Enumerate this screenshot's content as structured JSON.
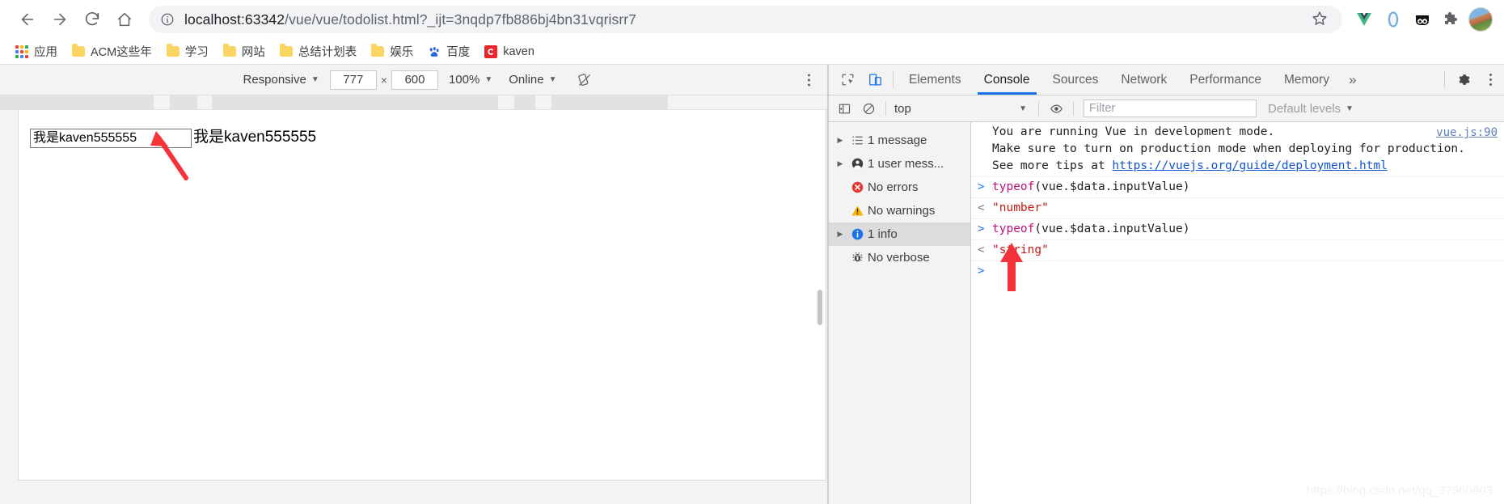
{
  "browser": {
    "nav": {
      "back": "back-arrow",
      "forward": "forward-arrow",
      "reload": "reload",
      "home": "home"
    },
    "address": {
      "host": "localhost:63342",
      "path": "/vue/vue/todolist.html?_ijt=3nqdp7fb886bj4bn31vqrisrr7",
      "full": "localhost:63342/vue/vue/todolist.html?_ijt=3nqdp7fb886bj4bn31vqrisrr7",
      "security_icon": "info-circle-icon",
      "bookmark_icon": "star-icon"
    },
    "bookmarks": [
      {
        "label": "应用",
        "icon": "apps-grid-icon"
      },
      {
        "label": "ACM这些年",
        "icon": "folder-icon"
      },
      {
        "label": "学习",
        "icon": "folder-icon"
      },
      {
        "label": "网站",
        "icon": "folder-icon"
      },
      {
        "label": "总结计划表",
        "icon": "folder-icon"
      },
      {
        "label": "娱乐",
        "icon": "folder-icon"
      },
      {
        "label": "百度",
        "icon": "baidu-paw-icon"
      },
      {
        "label": "kaven",
        "icon": "csdn-red-icon"
      }
    ],
    "extensions": [
      {
        "name": "vue-devtools-icon"
      },
      {
        "name": "blue-ring-icon"
      },
      {
        "name": "dark-panda-icon"
      },
      {
        "name": "puzzle-extensions-icon"
      },
      {
        "name": "profile-avatar"
      }
    ]
  },
  "device_toolbar": {
    "device": "Responsive",
    "width": "777",
    "height": "600",
    "times": "×",
    "zoom": "100%",
    "network": "Online",
    "rotate_icon": "rotate-icon",
    "menu_icon": "more-vertical-icon"
  },
  "page": {
    "input_value": "我是kaven555555",
    "echo_text": "我是kaven555555",
    "annotation_arrow": "red-arrow"
  },
  "devtools": {
    "tabs": [
      {
        "label": "Elements",
        "active": false
      },
      {
        "label": "Console",
        "active": true
      },
      {
        "label": "Sources",
        "active": false
      },
      {
        "label": "Network",
        "active": false
      },
      {
        "label": "Performance",
        "active": false
      },
      {
        "label": "Memory",
        "active": false
      }
    ],
    "more_tabs": "»",
    "settings_icon": "gear-icon",
    "menu_icon": "more-vertical-icon",
    "inspect_icon": "inspect-element-icon",
    "device_toggle_icon": "device-toolbar-icon",
    "filterbar": {
      "sidebar_toggle_icon": "console-sidebar-icon",
      "clear_icon": "clear-console-icon",
      "context": "top",
      "eye_icon": "live-expression-icon",
      "filter_placeholder": "Filter",
      "filter_value": "",
      "levels": "Default levels"
    },
    "console_sidebar": [
      {
        "label": "1 message",
        "icon": "list-icon",
        "expandable": true,
        "selected": false
      },
      {
        "label": "1 user mess...",
        "icon": "user-icon",
        "expandable": true,
        "selected": false
      },
      {
        "label": "No errors",
        "icon": "error-icon",
        "expandable": false,
        "selected": false
      },
      {
        "label": "No warnings",
        "icon": "warning-icon",
        "expandable": false,
        "selected": false
      },
      {
        "label": "1 info",
        "icon": "info-icon",
        "expandable": true,
        "selected": true
      },
      {
        "label": "No verbose",
        "icon": "bug-icon",
        "expandable": false,
        "selected": false
      }
    ],
    "console_messages": [
      {
        "type": "info",
        "line1": "You are running Vue in development mode.",
        "line2": "Make sure to turn on production mode when deploying for production.",
        "line3_prefix": "See more tips at ",
        "line3_link": "https://vuejs.org/guide/deployment.html",
        "source": "vue.js:90"
      },
      {
        "type": "command",
        "gutter": ">",
        "fn": "typeof",
        "rest": "(vue.$data.inputValue)"
      },
      {
        "type": "result",
        "gutter": "<",
        "value": "\"number\""
      },
      {
        "type": "command",
        "gutter": ">",
        "fn": "typeof",
        "rest": "(vue.$data.inputValue)"
      },
      {
        "type": "result",
        "gutter": "<",
        "value": "\"string\""
      },
      {
        "type": "prompt",
        "gutter": ">",
        "value": ""
      }
    ],
    "watermark": "https://blog.csdn.net/qq_37960603"
  },
  "colors": {
    "accent": "#1a73e8",
    "error": "#e53935",
    "warning": "#f5b400",
    "info": "#1a73e8",
    "arrow": "#f4333a",
    "string_value": "#c41a16",
    "keyword": "#b5157a"
  }
}
